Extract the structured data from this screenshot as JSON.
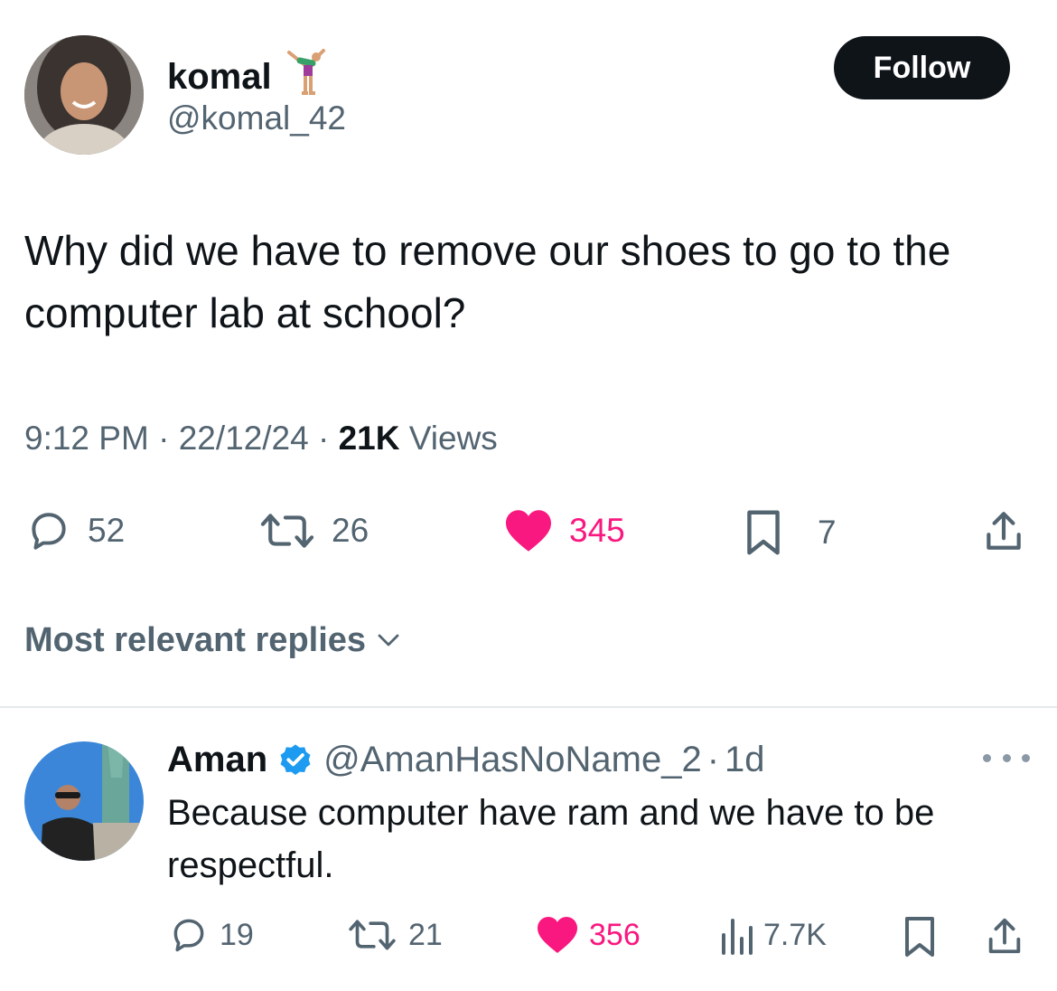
{
  "tweet": {
    "author": {
      "name": "komal",
      "handle": "@komal_42",
      "emoji": "cartwheel-emoji"
    },
    "follow_label": "Follow",
    "text": "Why did we have to remove our shoes to go to the computer lab at school?",
    "time": "9:12 PM",
    "sep1": " · ",
    "date": "22/12/24",
    "sep2": " · ",
    "views_count": "21K",
    "views_label": " Views",
    "stats": {
      "replies": "52",
      "reposts": "26",
      "likes": "345",
      "bookmarks": "7"
    },
    "icons": [
      "reply-icon",
      "repost-icon",
      "heart-icon",
      "bookmark-icon",
      "share-icon"
    ]
  },
  "replies_section": {
    "label": "Most relevant replies"
  },
  "reply": {
    "name": "Aman",
    "verified": true,
    "handle": "@AmanHasNoName_2",
    "sep": "·",
    "age": "1d",
    "text": "Because computer have ram and we have to be respectful.",
    "stats": {
      "replies": "19",
      "reposts": "21",
      "likes": "356",
      "views": "7.7K"
    }
  },
  "colors": {
    "text": "#0f1419",
    "secondary": "#536471",
    "like": "#f91880",
    "verified": "#1d9bf0",
    "follow_bg": "#0f1419"
  }
}
